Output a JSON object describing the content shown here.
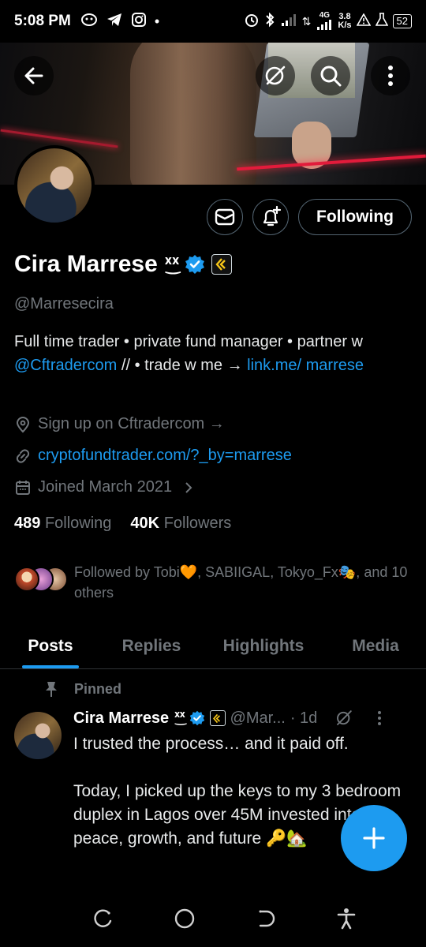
{
  "status_bar": {
    "time": "5:08 PM",
    "network": "4G",
    "speed_value": "3.8",
    "speed_unit": "K/s",
    "battery": "52"
  },
  "header": {
    "back_icon": "arrow-left-icon",
    "grok_icon": "grok-icon",
    "search_icon": "search-icon",
    "more_icon": "more-vertical-icon"
  },
  "profile": {
    "display_name": "Cira Marrese",
    "name_emoji": "ᕽ͜ᕽ",
    "handle": "@Marresecira",
    "bio": {
      "part1": "Full time trader • private fund manager • partner w ",
      "mention": "@Cftradercom",
      "part2": " // • trade w me → ",
      "link": "link.me/ marrese"
    },
    "location": "Sign up on Cftradercom →",
    "website": "cryptofundtrader.com/?_by=marrese",
    "joined": "Joined March 2021",
    "following_count": "489",
    "following_label": "Following",
    "followers_count": "40K",
    "followers_label": "Followers",
    "followed_by": "Followed by Tobi🧡, SABIIGAL, Tokyo_Fx🎭, and 10 others",
    "following_button": "Following"
  },
  "tabs": [
    {
      "label": "Posts",
      "active": true
    },
    {
      "label": "Replies",
      "active": false
    },
    {
      "label": "Highlights",
      "active": false
    },
    {
      "label": "Media",
      "active": false
    }
  ],
  "pinned_post": {
    "pinned_label": "Pinned",
    "author_name": "Cira Marrese",
    "author_emoji": "ᕽ͜ᕽ",
    "author_handle": "@Mar...",
    "time": "· 1d",
    "text": "I trusted the process… and it paid off.\n\nToday, I picked up the keys to my 3 bedroom duplex in Lagos over 45M invested into my peace, growth, and future 🔑🏡"
  },
  "colors": {
    "accent": "#1d9bf0",
    "muted": "#71767b",
    "background": "#000000"
  }
}
